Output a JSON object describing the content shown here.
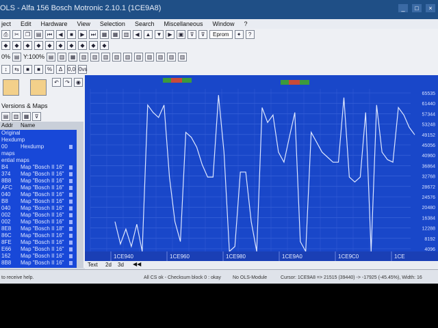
{
  "titlebar": {
    "title": "OLS - Alfa 156 Bosch Motronic 2.10.1 (1CE9A8)"
  },
  "menu": [
    "ject",
    "Edit",
    "Hardware",
    "View",
    "Selection",
    "Search",
    "Miscellaneous",
    "Window",
    "?"
  ],
  "toolbar": {
    "eprom_label": "Eprom",
    "zoom_x": "0%",
    "zoom_y": "Y:100%",
    "percent_symbol": "%",
    "delta_symbol": "Δ",
    "zero_label": "0,0",
    "ovs_label": "0vs"
  },
  "sidebar": {
    "versions_label": "Versions & Maps",
    "columns": [
      "Addr",
      "Name"
    ],
    "rows": [
      {
        "addr": "Original",
        "name": ""
      },
      {
        "addr": "Hexdump",
        "name": ""
      },
      {
        "addr": "00",
        "name": "Hexdump"
      },
      {
        "addr": "maps",
        "name": ""
      },
      {
        "addr": "ential maps",
        "name": ""
      },
      {
        "addr": "B4",
        "name": "Map \"Bosch II 16\""
      },
      {
        "addr": "374",
        "name": "Map \"Bosch II 16\""
      },
      {
        "addr": "8B8",
        "name": "Map \"Bosch II 16\""
      },
      {
        "addr": "AFC",
        "name": "Map \"Bosch II 16\""
      },
      {
        "addr": "040",
        "name": "Map \"Bosch II 16\""
      },
      {
        "addr": "B8",
        "name": "Map \"Bosch II 16\""
      },
      {
        "addr": "040",
        "name": "Map \"Bosch II 16\""
      },
      {
        "addr": "002",
        "name": "Map \"Bosch II 16\""
      },
      {
        "addr": "002",
        "name": "Map \"Bosch II 16\""
      },
      {
        "addr": "8E8",
        "name": "Map \"Bosch II 18\""
      },
      {
        "addr": "86C",
        "name": "Map \"Bosch II 16\""
      },
      {
        "addr": "8FE",
        "name": "Map \"Bosch II 16\""
      },
      {
        "addr": "E66",
        "name": "Map \"Bosch II 16\""
      },
      {
        "addr": "162",
        "name": "Map \"Bosch II 16\""
      },
      {
        "addr": "8B8",
        "name": "Map \"Bosch II 16\""
      }
    ]
  },
  "graph": {
    "y_ticks": [
      "65535",
      "61440",
      "57344",
      "53248",
      "49152",
      "45056",
      "40960",
      "36864",
      "32768",
      "28672",
      "24576",
      "20480",
      "16384",
      "12288",
      "8192",
      "4096"
    ],
    "x_ticks": [
      "1CE940",
      "1CE960",
      "1CE980",
      "1CE9A0",
      "1CE9C0",
      "1CE"
    ],
    "tabs": [
      "Text",
      "2d",
      "3d"
    ]
  },
  "chart_data": {
    "type": "line",
    "ylim": [
      0,
      65535
    ],
    "x_labels": [
      "1CE940",
      "1CE960",
      "1CE980",
      "1CE9A0",
      "1CE9C0",
      "1CE"
    ],
    "series": [
      {
        "values": [
          12000,
          3000,
          9000,
          2000,
          11000,
          0,
          59000,
          56000,
          54000,
          59000,
          30000,
          12000,
          4000,
          48000,
          46000,
          42000,
          35000,
          30000,
          30000,
          63000,
          40000,
          0,
          2000,
          32000,
          32000,
          12000,
          0,
          58000,
          52000,
          55000,
          40000,
          36000,
          46000,
          56000,
          4000,
          0,
          48000,
          44000,
          40000,
          38000,
          36000,
          36000,
          62000,
          30000,
          28000,
          30000,
          56000,
          0,
          59000,
          40000,
          37000,
          36000,
          58000,
          55000,
          50000,
          47000
        ]
      }
    ]
  },
  "status": {
    "help": "to receive help.",
    "checksum": "All CS ok - Checksum block 0 : okay",
    "module": "No OLS-Module",
    "cursor": "Cursor: 1CE9A8 => 21515 (39440) -> -17925 (-45.45%), Width: 16"
  }
}
